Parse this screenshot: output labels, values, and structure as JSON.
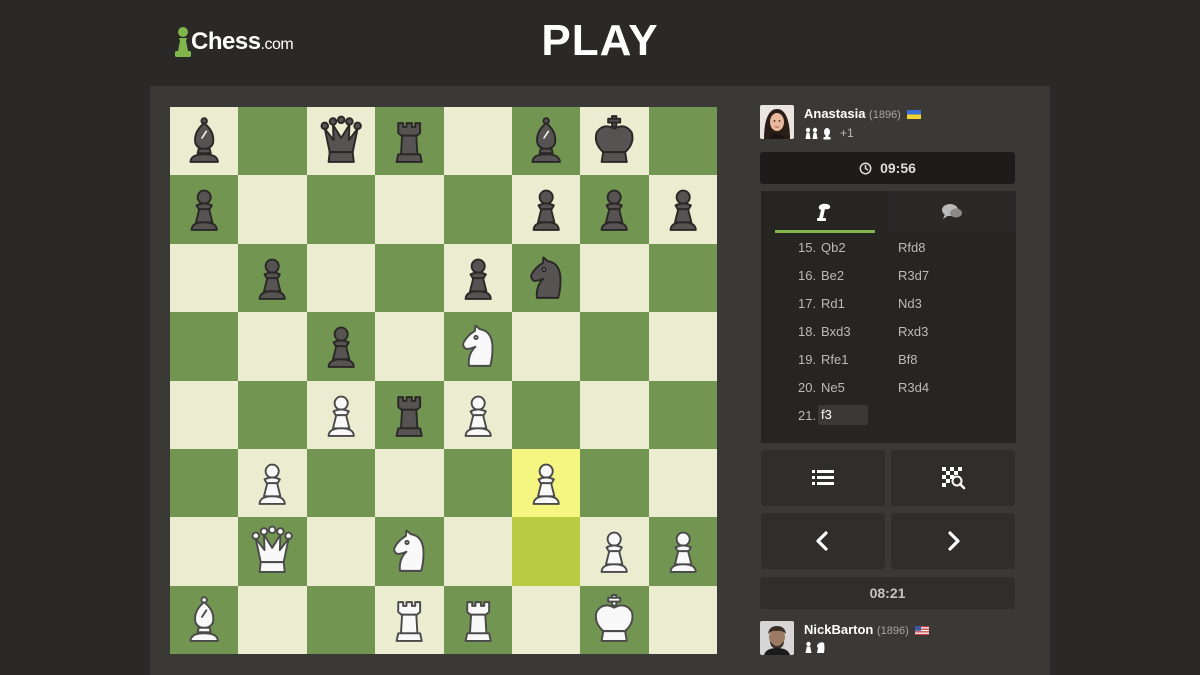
{
  "header": {
    "logo_text": "Chess",
    "logo_suffix": ".com",
    "title": "PLAY"
  },
  "board": {
    "colors": {
      "light": "#ebecd0",
      "dark": "#739552",
      "highlight_light": "#f5f682",
      "highlight_dark": "#b9ca43"
    },
    "highlighted_squares": [
      "f3",
      "f2"
    ],
    "ranks": [
      [
        "bB",
        "",
        "bQ",
        "bR",
        "",
        "bB",
        "bK",
        ""
      ],
      [
        "bP",
        "",
        "",
        "",
        "",
        "bP",
        "bP",
        "bP"
      ],
      [
        "",
        "bP",
        "",
        "",
        "bP",
        "bN",
        "",
        ""
      ],
      [
        "",
        "",
        "bP",
        "",
        "wN",
        "",
        "",
        ""
      ],
      [
        "",
        "",
        "wP",
        "bR",
        "wP",
        "",
        "",
        ""
      ],
      [
        "",
        "wP",
        "",
        "",
        "",
        "wP",
        "",
        ""
      ],
      [
        "",
        "wQ",
        "",
        "wN",
        "",
        "",
        "wP",
        "wP"
      ],
      [
        "wB",
        "",
        "",
        "wR",
        "wR",
        "",
        "wK",
        ""
      ]
    ]
  },
  "top_player": {
    "name": "Anastasia",
    "rating": "(1896)",
    "flag": "ukraine",
    "captured_icons": [
      "pawn",
      "pawn",
      "bishop"
    ],
    "advantage": "+1",
    "clock": "09:56"
  },
  "bottom_player": {
    "name": "NickBarton",
    "rating": "(1896)",
    "flag": "usa",
    "captured_icons": [
      "pawn",
      "knight"
    ],
    "clock": "08:21"
  },
  "moves_panel": {
    "tabs": [
      {
        "name": "moves",
        "icon": "pawn-hand-icon",
        "active": true
      },
      {
        "name": "chat",
        "icon": "chat-icon",
        "active": false
      }
    ],
    "moves": [
      {
        "num": "15.",
        "white": "Qb2",
        "black": "Rfd8"
      },
      {
        "num": "16.",
        "white": "Be2",
        "black": "R3d7"
      },
      {
        "num": "17.",
        "white": "Rd1",
        "black": "Nd3"
      },
      {
        "num": "18.",
        "white": "Bxd3",
        "black": "Rxd3"
      },
      {
        "num": "19.",
        "white": "Rfe1",
        "black": "Bf8"
      },
      {
        "num": "20.",
        "white": "Ne5",
        "black": "R3d4"
      },
      {
        "num": "21.",
        "white": "f3",
        "black": ""
      }
    ],
    "current_move_index": 6
  },
  "controls": [
    {
      "name": "move-list-button",
      "icon": "list-icon"
    },
    {
      "name": "analysis-button",
      "icon": "board-search-icon"
    },
    {
      "name": "previous-move-button",
      "icon": "chevron-left-icon"
    },
    {
      "name": "next-move-button",
      "icon": "chevron-right-icon"
    }
  ]
}
